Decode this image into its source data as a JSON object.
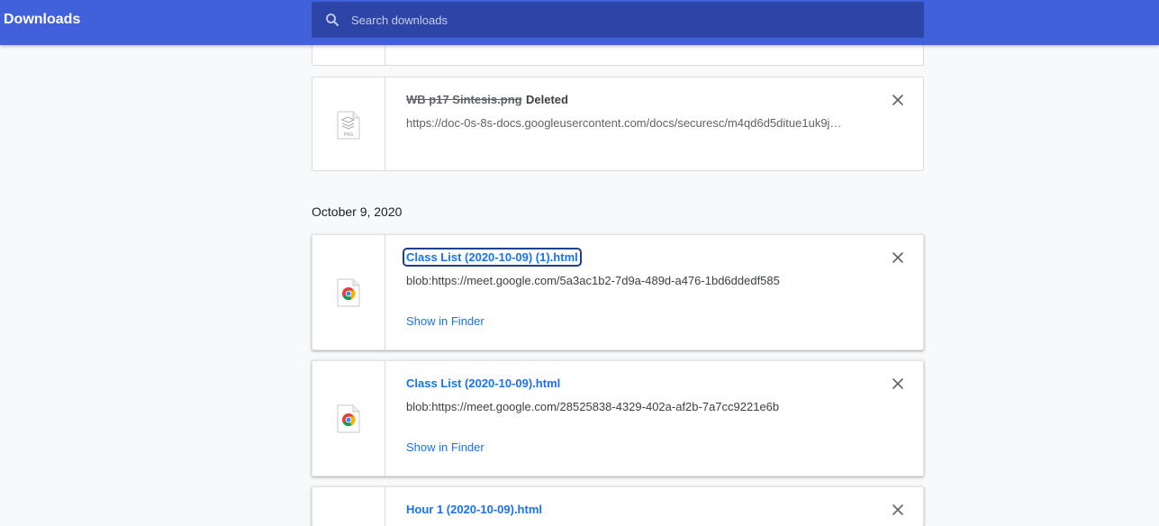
{
  "toolbar": {
    "title": "Downloads",
    "search_placeholder": "Search downloads",
    "colors": {
      "toolbar": "#4161db",
      "search": "#2e45a8"
    }
  },
  "items_before": [
    {
      "name": "WB p17 Sintesis.png",
      "status": "Deleted",
      "url": "https://doc-0s-8s-docs.googleusercontent.com/docs/securesc/m4qd6d5ditue1uk9j…",
      "icon": "png-file-icon"
    }
  ],
  "date_group": {
    "date": "October 9, 2020",
    "items": [
      {
        "name": "Class List (2020-10-09) (1).html",
        "url": "blob:https://meet.google.com/5a3ac1b2-7d9a-489d-a476-1bd6ddedf585",
        "action": "Show in Finder",
        "icon": "chrome-file-icon"
      },
      {
        "name": "Class List (2020-10-09).html",
        "url": "blob:https://meet.google.com/28525838-4329-402a-af2b-7a7cc9221e6b",
        "action": "Show in Finder",
        "icon": "chrome-file-icon"
      },
      {
        "name": "Hour 1 (2020-10-09).html",
        "icon": "chrome-file-icon"
      }
    ]
  },
  "colors": {
    "link": "#1a73e8",
    "background": "#f8f9fa"
  }
}
